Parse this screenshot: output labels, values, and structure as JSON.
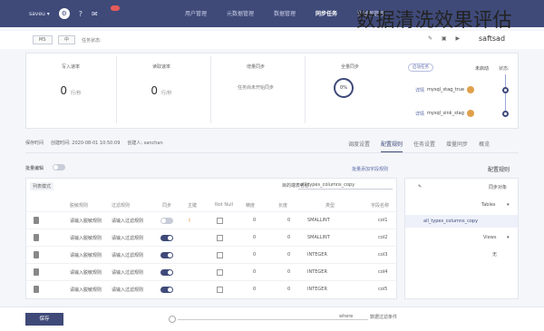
{
  "overlay_title": "数据清洗效果评估",
  "topbar": {
    "workspace_select": "saveu ▾",
    "nav": [
      "应用管理",
      "数据源管理",
      "同步任务",
      "数据管理",
      "元数据管理",
      "用户管理"
    ],
    "active_nav": "同步任务"
  },
  "crumb": {
    "tag1": "MS",
    "tag2": "中",
    "label": "任务状态:",
    "title": "saftsad"
  },
  "metrics": [
    {
      "title": "全量同步",
      "percent": "0%"
    },
    {
      "title": "增量同步",
      "note": "任务尚未开始同步"
    },
    {
      "title": "读取速率",
      "value": "0",
      "unit": "行/秒"
    },
    {
      "title": "写入速率",
      "value": "0",
      "unit": "行/秒"
    }
  ],
  "status": {
    "label": "状态:",
    "value": "未启动",
    "chip": "启动任务"
  },
  "sources": [
    {
      "name": "mysql_stag_true",
      "link": "详情"
    },
    {
      "name": "mysql_sink_stag",
      "link": "详情"
    }
  ],
  "infobar": [
    "创建人: sanchan",
    "创建时间: 2020-08-01 10:50:09",
    "保存时间"
  ],
  "tabs": [
    "概览",
    "增量同步",
    "任务设置",
    "配置规则",
    "调度设置"
  ],
  "active_tab": "配置规则",
  "section": {
    "rules_label": "配置规则",
    "add_link": "批量添加字段规则",
    "toggle_label": "批量编辑"
  },
  "table": {
    "left_tag": "列表模式",
    "filter_label": "目的端表名称",
    "filter_value": "all_types_columns_copy",
    "headers": [
      "字段名称",
      "类型",
      "长度",
      "精度",
      "Not Null",
      "主键",
      "同步",
      "过滤规则",
      "脱敏规则",
      "转换规则"
    ],
    "rows": [
      {
        "name": "col1",
        "type": "SMALLINT",
        "len": "0",
        "prec": "0",
        "on": false,
        "rule_a": "请输入过滤规则",
        "rule_b": "请输入脱敏规则",
        "rule_c": "请输入转换规则"
      },
      {
        "name": "col2",
        "type": "SMALLINT",
        "len": "0",
        "prec": "0",
        "on": true,
        "rule_a": "请输入过滤规则",
        "rule_b": "请输入脱敏规则",
        "rule_c": "请输入转换规则"
      },
      {
        "name": "col3",
        "type": "INTEGER",
        "len": "0",
        "prec": "0",
        "on": true,
        "rule_a": "请输入过滤规则",
        "rule_b": "请输入脱敏规则",
        "rule_c": "请输入转换规则"
      },
      {
        "name": "col4",
        "type": "INTEGER",
        "len": "0",
        "prec": "0",
        "on": true,
        "rule_a": "请输入过滤规则",
        "rule_b": "请输入脱敏规则",
        "rule_c": "请输入转换规则"
      },
      {
        "name": "col5",
        "type": "INTEGER",
        "len": "0",
        "prec": "0",
        "on": true,
        "rule_a": "请输入过滤规则",
        "rule_b": "请输入脱敏规则",
        "rule_c": "请输入转换规则"
      }
    ]
  },
  "tree": {
    "title": "同步对象",
    "tables": "Tables",
    "selected": "all_types_columns_copy",
    "views": "Views",
    "none": "无"
  },
  "footer": {
    "save": "保存",
    "where": "where",
    "label2": "数据过滤条件"
  }
}
